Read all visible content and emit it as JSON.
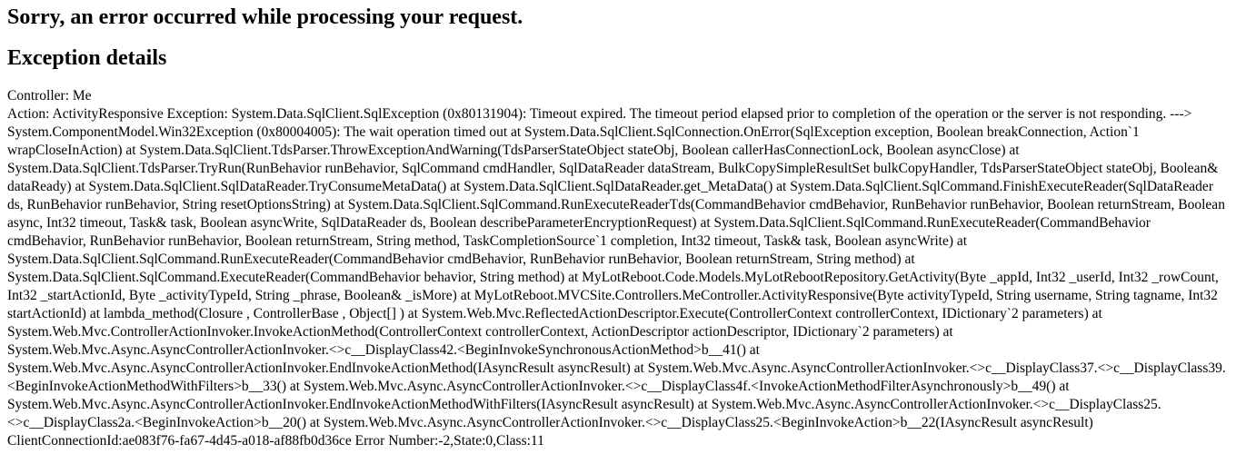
{
  "heading1": "Sorry, an error occurred while processing your request.",
  "heading2": "Exception details",
  "details": {
    "line1": "Controller: Me",
    "line2": "Action: ActivityResponsive Exception: System.Data.SqlClient.SqlException (0x80131904): Timeout expired. The timeout period elapsed prior to completion of the operation or the server is not responding. ---> System.ComponentModel.Win32Exception (0x80004005): The wait operation timed out at System.Data.SqlClient.SqlConnection.OnError(SqlException exception, Boolean breakConnection, Action`1 wrapCloseInAction) at System.Data.SqlClient.TdsParser.ThrowExceptionAndWarning(TdsParserStateObject stateObj, Boolean callerHasConnectionLock, Boolean asyncClose) at System.Data.SqlClient.TdsParser.TryRun(RunBehavior runBehavior, SqlCommand cmdHandler, SqlDataReader dataStream, BulkCopySimpleResultSet bulkCopyHandler, TdsParserStateObject stateObj, Boolean& dataReady) at System.Data.SqlClient.SqlDataReader.TryConsumeMetaData() at System.Data.SqlClient.SqlDataReader.get_MetaData() at System.Data.SqlClient.SqlCommand.FinishExecuteReader(SqlDataReader ds, RunBehavior runBehavior, String resetOptionsString) at System.Data.SqlClient.SqlCommand.RunExecuteReaderTds(CommandBehavior cmdBehavior, RunBehavior runBehavior, Boolean returnStream, Boolean async, Int32 timeout, Task& task, Boolean asyncWrite, SqlDataReader ds, Boolean describeParameterEncryptionRequest) at System.Data.SqlClient.SqlCommand.RunExecuteReader(CommandBehavior cmdBehavior, RunBehavior runBehavior, Boolean returnStream, String method, TaskCompletionSource`1 completion, Int32 timeout, Task& task, Boolean asyncWrite) at System.Data.SqlClient.SqlCommand.RunExecuteReader(CommandBehavior cmdBehavior, RunBehavior runBehavior, Boolean returnStream, String method) at System.Data.SqlClient.SqlCommand.ExecuteReader(CommandBehavior behavior, String method) at MyLotReboot.Code.Models.MyLotRebootRepository.GetActivity(Byte _appId, Int32 _userId, Int32 _rowCount, Int32 _startActionId, Byte _activityTypeId, String _phrase, Boolean& _isMore) at MyLotReboot.MVCSite.Controllers.MeController.ActivityResponsive(Byte activityTypeId, String username, String tagname, Int32 startActionId) at lambda_method(Closure , ControllerBase , Object[] ) at System.Web.Mvc.ReflectedActionDescriptor.Execute(ControllerContext controllerContext, IDictionary`2 parameters) at System.Web.Mvc.ControllerActionInvoker.InvokeActionMethod(ControllerContext controllerContext, ActionDescriptor actionDescriptor, IDictionary`2 parameters) at System.Web.Mvc.Async.AsyncControllerActionInvoker.<>c__DisplayClass42.<BeginInvokeSynchronousActionMethod>b__41() at System.Web.Mvc.Async.AsyncControllerActionInvoker.EndInvokeActionMethod(IAsyncResult asyncResult) at System.Web.Mvc.Async.AsyncControllerActionInvoker.<>c__DisplayClass37.<>c__DisplayClass39.<BeginInvokeActionMethodWithFilters>b__33() at System.Web.Mvc.Async.AsyncControllerActionInvoker.<>c__DisplayClass4f.<InvokeActionMethodFilterAsynchronously>b__49() at System.Web.Mvc.Async.AsyncControllerActionInvoker.EndInvokeActionMethodWithFilters(IAsyncResult asyncResult) at System.Web.Mvc.Async.AsyncControllerActionInvoker.<>c__DisplayClass25.<>c__DisplayClass2a.<BeginInvokeAction>b__20() at System.Web.Mvc.Async.AsyncControllerActionInvoker.<>c__DisplayClass25.<BeginInvokeAction>b__22(IAsyncResult asyncResult) ClientConnectionId:ae083f76-fa67-4d45-a018-af88fb0d36ce Error Number:-2,State:0,Class:11"
  }
}
